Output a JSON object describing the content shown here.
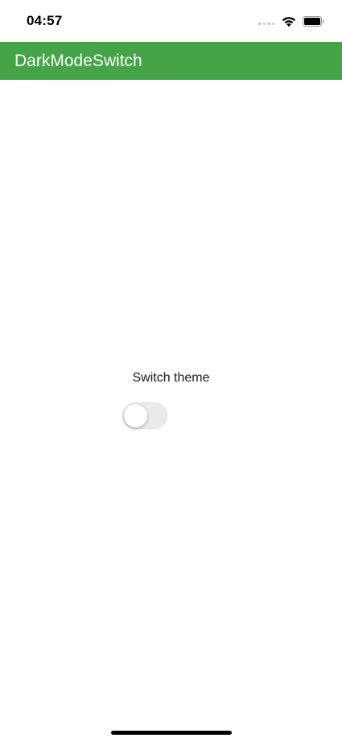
{
  "status_bar": {
    "time": "04:57",
    "icons": [
      "signal-dots-icon",
      "wifi-icon",
      "battery-icon"
    ]
  },
  "app_bar": {
    "title": "DarkModeSwitch",
    "color": "#45a447"
  },
  "main": {
    "switch_label": "Switch theme",
    "switch_on": false
  }
}
